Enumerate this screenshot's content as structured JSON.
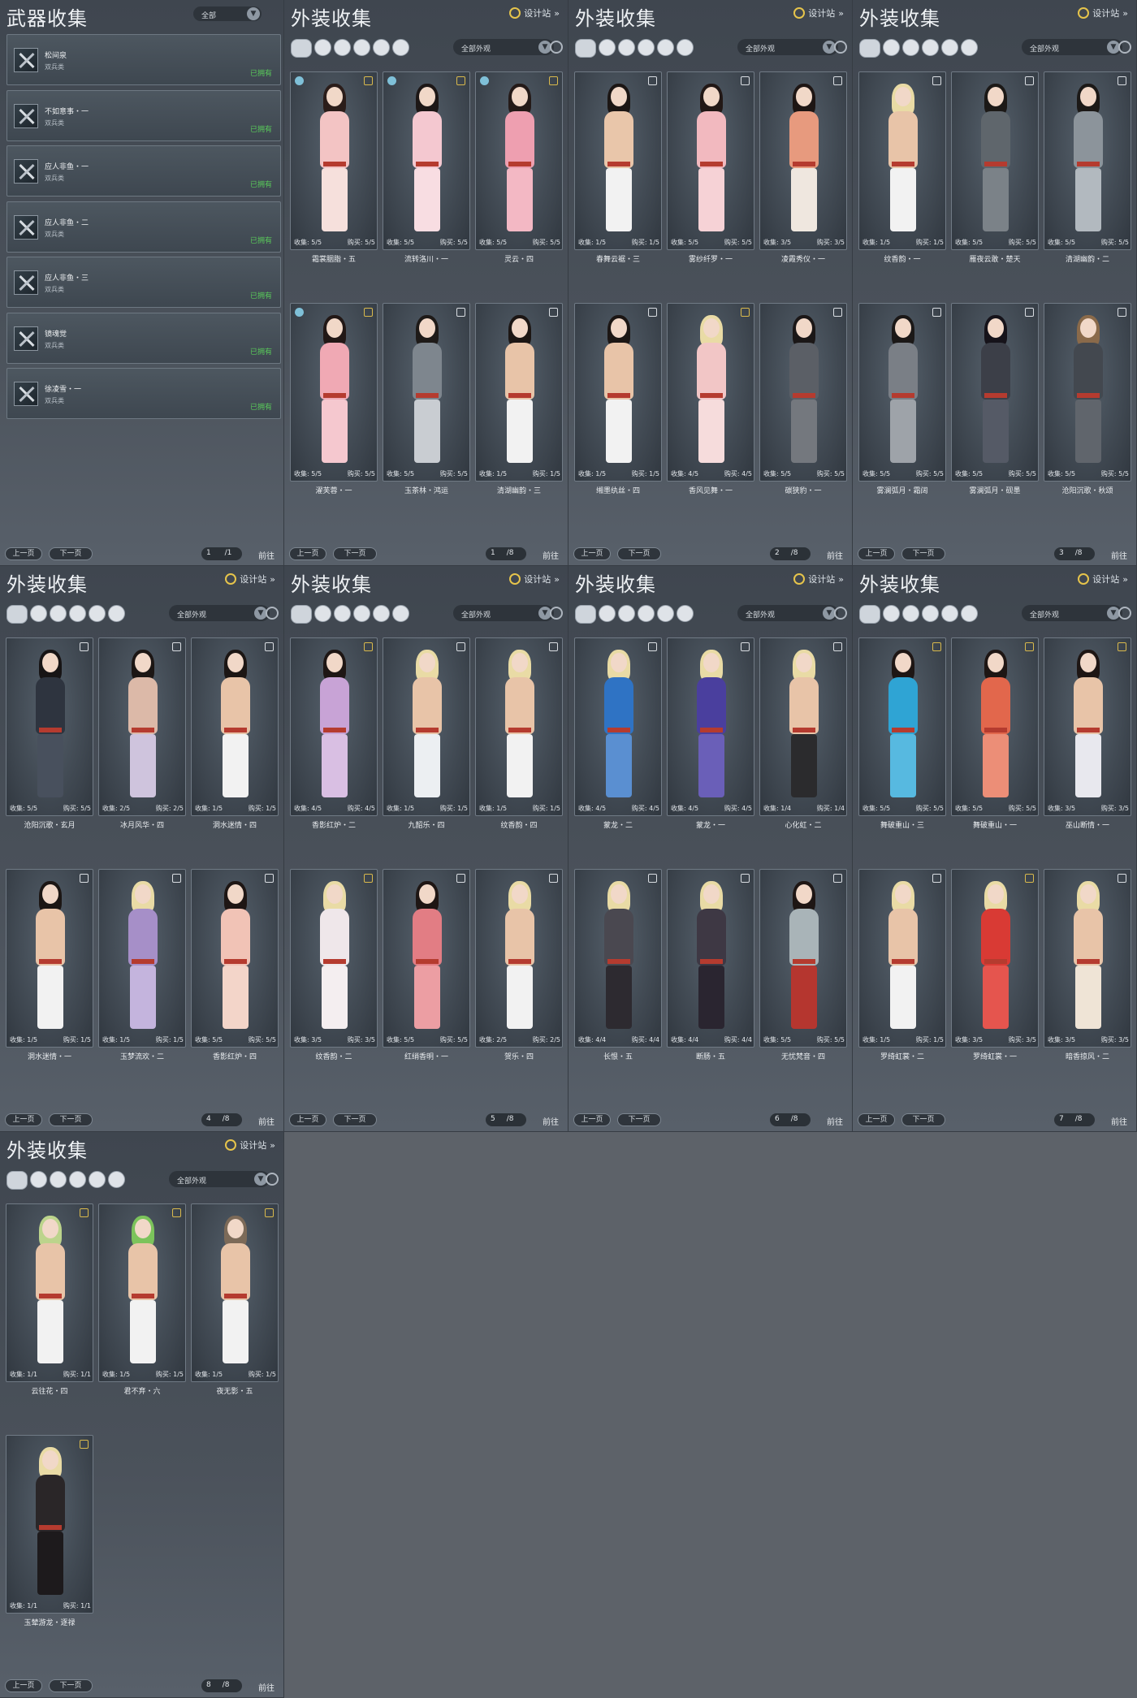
{
  "weapon": {
    "title": "武器收集",
    "filter": "全部",
    "items": [
      {
        "name": "松间泉",
        "type": "双兵类",
        "status": "已拥有"
      },
      {
        "name": "不如意事・一",
        "type": "双兵类",
        "status": "已拥有"
      },
      {
        "name": "应人非鱼・一",
        "type": "双兵类",
        "status": "已拥有"
      },
      {
        "name": "应人非鱼・二",
        "type": "双兵类",
        "status": "已拥有"
      },
      {
        "name": "应人非鱼・三",
        "type": "双兵类",
        "status": "已拥有"
      },
      {
        "name": "镜魂觉",
        "type": "双兵类",
        "status": "已拥有"
      },
      {
        "name": "徐凌雪・一",
        "type": "双兵类",
        "status": "已拥有"
      }
    ],
    "pager": {
      "prev": "上一页",
      "next": "下一页",
      "page": "1",
      "total": "/1",
      "jump": "前往"
    }
  },
  "outfit_common": {
    "title": "外装收集",
    "designer": "设计站",
    "filter": "全部外观",
    "collect_label": "收集:",
    "buy_label": "购买:",
    "prev": "上一页",
    "next": "下一页",
    "jump": "前往"
  },
  "outfit_pages": [
    {
      "page": "1",
      "total": "/8",
      "cards": [
        {
          "name": "霜裳胭脂・五",
          "collect": "5/5",
          "buy": "5/5",
          "tag": "gold",
          "left": true,
          "palette": [
            "#f3c4c4",
            "#2b1d1a",
            "#f6e0dc"
          ]
        },
        {
          "name": "流转洛川・一",
          "collect": "5/5",
          "buy": "5/5",
          "tag": "gold",
          "left": true,
          "palette": [
            "#f4c8d0",
            "#1d1716",
            "#f8dde2"
          ]
        },
        {
          "name": "灵云・四",
          "collect": "5/5",
          "buy": "5/5",
          "tag": "gold",
          "left": true,
          "palette": [
            "#ee9fb0",
            "#241a18",
            "#f3b8c4"
          ]
        },
        {
          "name": "濯芙蓉・一",
          "collect": "5/5",
          "buy": "5/5",
          "tag": "gold",
          "left": true,
          "palette": [
            "#f0a9b4",
            "#221816",
            "#f5c8cf"
          ]
        },
        {
          "name": "玉茶林・鸿运",
          "collect": "5/5",
          "buy": "5/5",
          "tag": "silver",
          "left": false,
          "palette": [
            "#7e868e",
            "#1e1a18",
            "#c9cdd2"
          ]
        },
        {
          "name": "清湖幽韵・三",
          "collect": "1/5",
          "buy": "1/5",
          "tag": "silver",
          "left": false,
          "palette": [
            "#e8c4a8",
            "#1c1614",
            "#f2f2f2"
          ]
        }
      ]
    },
    {
      "page": "2",
      "total": "/8",
      "cards": [
        {
          "name": "春舞云裾・三",
          "collect": "1/5",
          "buy": "1/5",
          "tag": "silver",
          "left": false,
          "palette": [
            "#e9c6aa",
            "#1c1614",
            "#f2f2f2"
          ]
        },
        {
          "name": "雾纱纤罗・一",
          "collect": "5/5",
          "buy": "5/5",
          "tag": "silver",
          "left": false,
          "palette": [
            "#f2b9bf",
            "#221816",
            "#f6d2d6"
          ]
        },
        {
          "name": "凌霞秀仪・一",
          "collect": "3/5",
          "buy": "3/5",
          "tag": "silver",
          "left": false,
          "palette": [
            "#e79a7e",
            "#1e1614",
            "#efe7df"
          ]
        },
        {
          "name": "缃墨纨丝・四",
          "collect": "1/5",
          "buy": "1/5",
          "tag": "silver",
          "left": false,
          "palette": [
            "#e8c4a8",
            "#1c1614",
            "#f2f2f2"
          ]
        },
        {
          "name": "香风见舞・一",
          "collect": "4/5",
          "buy": "4/5",
          "tag": "gold",
          "left": false,
          "palette": [
            "#f2c6c6",
            "#e9dba5",
            "#f6dcdc"
          ]
        },
        {
          "name": "碳狭豹・一",
          "collect": "5/5",
          "buy": "5/5",
          "tag": "silver",
          "left": false,
          "palette": [
            "#5b5f66",
            "#1b1717",
            "#74787e"
          ]
        }
      ]
    },
    {
      "page": "3",
      "total": "/8",
      "cards": [
        {
          "name": "纹香韵・一",
          "collect": "1/5",
          "buy": "1/5",
          "tag": "silver",
          "left": false,
          "palette": [
            "#e8c4a8",
            "#e9dba5",
            "#f2f2f2"
          ]
        },
        {
          "name": "雁夜云敢・楚天",
          "collect": "5/5",
          "buy": "5/5",
          "tag": "silver",
          "left": false,
          "palette": [
            "#5f666c",
            "#1c1917",
            "#7b8288"
          ]
        },
        {
          "name": "清湖幽韵・二",
          "collect": "5/5",
          "buy": "5/5",
          "tag": "silver",
          "left": false,
          "palette": [
            "#8c949b",
            "#1c1917",
            "#b2b9bf"
          ]
        },
        {
          "name": "雾澜弧月・霜阔",
          "collect": "5/5",
          "buy": "5/5",
          "tag": "silver",
          "left": false,
          "palette": [
            "#7a7f86",
            "#1b1817",
            "#9ea3a9"
          ]
        },
        {
          "name": "雾澜弧月・砚墨",
          "collect": "5/5",
          "buy": "5/5",
          "tag": "silver",
          "left": false,
          "palette": [
            "#3c3f48",
            "#16131a",
            "#555a66"
          ]
        },
        {
          "name": "沧阳沉歌・秋颂",
          "collect": "5/5",
          "buy": "5/5",
          "tag": "silver",
          "left": false,
          "palette": [
            "#43484f",
            "#8a6a4a",
            "#60656c"
          ]
        }
      ]
    },
    {
      "page": "4",
      "total": "/8",
      "cards": [
        {
          "name": "沧阳沉歌・玄月",
          "collect": "5/5",
          "buy": "5/5",
          "tag": "silver",
          "left": false,
          "palette": [
            "#2e343f",
            "#171415",
            "#48505d"
          ]
        },
        {
          "name": "冰月风华・四",
          "collect": "2/5",
          "buy": "2/5",
          "tag": "silver",
          "left": false,
          "palette": [
            "#dcb9a8",
            "#1c1614",
            "#cfc4dd"
          ]
        },
        {
          "name": "洞水迷情・四",
          "collect": "1/5",
          "buy": "1/5",
          "tag": "silver",
          "left": false,
          "palette": [
            "#e8c4a8",
            "#1c1614",
            "#f2f2f2"
          ]
        },
        {
          "name": "洞水迷情・一",
          "collect": "1/5",
          "buy": "1/5",
          "tag": "silver",
          "left": false,
          "palette": [
            "#e8c4a8",
            "#1c1614",
            "#f2f2f2"
          ]
        },
        {
          "name": "玉梦流欢・二",
          "collect": "1/5",
          "buy": "1/5",
          "tag": "silver",
          "left": false,
          "palette": [
            "#a68fc8",
            "#e9dba5",
            "#c4b4dd"
          ]
        },
        {
          "name": "香影红炉・四",
          "collect": "5/5",
          "buy": "5/5",
          "tag": "silver",
          "left": false,
          "palette": [
            "#f1c3b6",
            "#1e1614",
            "#f3d5c9"
          ]
        }
      ]
    },
    {
      "page": "5",
      "total": "/8",
      "cards": [
        {
          "name": "香影红炉・二",
          "collect": "4/5",
          "buy": "4/5",
          "tag": "gold",
          "left": false,
          "palette": [
            "#c8a3d6",
            "#1e1614",
            "#d9bfe3"
          ]
        },
        {
          "name": "九韶乐・四",
          "collect": "1/5",
          "buy": "1/5",
          "tag": "silver",
          "left": false,
          "palette": [
            "#e8c4a8",
            "#e9dba5",
            "#eceff2"
          ]
        },
        {
          "name": "纹香韵・四",
          "collect": "1/5",
          "buy": "1/5",
          "tag": "silver",
          "left": false,
          "palette": [
            "#e8c4a8",
            "#e9dba5",
            "#f2f2f2"
          ]
        },
        {
          "name": "纹香韵・二",
          "collect": "3/5",
          "buy": "3/5",
          "tag": "gold",
          "left": false,
          "palette": [
            "#efe7ea",
            "#e9dba5",
            "#f4eef0"
          ]
        },
        {
          "name": "红绡香明・一",
          "collect": "5/5",
          "buy": "5/5",
          "tag": "silver",
          "left": false,
          "palette": [
            "#e27d84",
            "#1e1614",
            "#ec9ea3"
          ]
        },
        {
          "name": "贺乐・四",
          "collect": "2/5",
          "buy": "2/5",
          "tag": "silver",
          "left": false,
          "palette": [
            "#e8c4a8",
            "#e9dba5",
            "#f2f2f2"
          ]
        }
      ]
    },
    {
      "page": "6",
      "total": "/8",
      "cards": [
        {
          "name": "蒙龙・二",
          "collect": "4/5",
          "buy": "4/5",
          "tag": "silver",
          "left": false,
          "palette": [
            "#2f73c4",
            "#e9dba5",
            "#5a8fd1"
          ]
        },
        {
          "name": "蒙龙・一",
          "collect": "4/5",
          "buy": "4/5",
          "tag": "silver",
          "left": false,
          "palette": [
            "#4a3f9e",
            "#e9dba5",
            "#6a5fb8"
          ]
        },
        {
          "name": "心化虹・二",
          "collect": "1/4",
          "buy": "1/4",
          "tag": "silver",
          "left": false,
          "palette": [
            "#e8c4a8",
            "#e9dba5",
            "#2b2b2d"
          ]
        },
        {
          "name": "长恨・五",
          "collect": "4/4",
          "buy": "4/4",
          "tag": "silver",
          "left": false,
          "palette": [
            "#4a4850",
            "#e9dba5",
            "#2d2a30"
          ]
        },
        {
          "name": "断肠・五",
          "collect": "4/4",
          "buy": "4/4",
          "tag": "silver",
          "left": false,
          "palette": [
            "#3e3844",
            "#e9dba5",
            "#2a2530"
          ]
        },
        {
          "name": "无忧梵音・四",
          "collect": "5/5",
          "buy": "5/5",
          "tag": "silver",
          "left": false,
          "palette": [
            "#a9b4b8",
            "#1e1614",
            "#b5362f"
          ]
        }
      ]
    },
    {
      "page": "7",
      "total": "/8",
      "cards": [
        {
          "name": "舞破重山・三",
          "collect": "5/5",
          "buy": "5/5",
          "tag": "gold",
          "left": false,
          "palette": [
            "#2fa4d4",
            "#1e1614",
            "#57b9e0"
          ]
        },
        {
          "name": "舞破重山・一",
          "collect": "5/5",
          "buy": "5/5",
          "tag": "gold",
          "left": false,
          "palette": [
            "#e2674c",
            "#1e1614",
            "#ec8e77"
          ]
        },
        {
          "name": "巫山断情・一",
          "collect": "3/5",
          "buy": "3/5",
          "tag": "gold",
          "left": false,
          "palette": [
            "#e8c4a8",
            "#1e1614",
            "#e8e8ee"
          ]
        },
        {
          "name": "罗绮虹裳・二",
          "collect": "1/5",
          "buy": "1/5",
          "tag": "silver",
          "left": false,
          "palette": [
            "#e8c4a8",
            "#e9dba5",
            "#f2f2f2"
          ]
        },
        {
          "name": "罗绮虹裳・一",
          "collect": "3/5",
          "buy": "3/5",
          "tag": "gold",
          "left": false,
          "palette": [
            "#d93a34",
            "#e9dba5",
            "#e5554e"
          ]
        },
        {
          "name": "暗香掠风・二",
          "collect": "3/5",
          "buy": "3/5",
          "tag": "silver",
          "left": false,
          "palette": [
            "#e8c4a8",
            "#e9dba5",
            "#efe4d6"
          ]
        }
      ]
    },
    {
      "page": "8",
      "total": "/8",
      "cards": [
        {
          "name": "云往花・四",
          "collect": "1/1",
          "buy": "1/1",
          "tag": "gold",
          "left": false,
          "palette": [
            "#e8c4a8",
            "#bcd48c",
            "#f2f2f2"
          ]
        },
        {
          "name": "君不弃・六",
          "collect": "1/5",
          "buy": "1/5",
          "tag": "gold",
          "left": false,
          "palette": [
            "#e8c4a8",
            "#7bc35b",
            "#f2f2f2"
          ]
        },
        {
          "name": "夜无影・五",
          "collect": "1/5",
          "buy": "1/5",
          "tag": "gold",
          "left": false,
          "palette": [
            "#e8c4a8",
            "#7c6a58",
            "#f2f2f2"
          ]
        },
        {
          "name": "玉辇游龙・逐禄",
          "collect": "1/1",
          "buy": "1/1",
          "tag": "gold",
          "left": false,
          "palette": [
            "#2a2628",
            "#e9dba5",
            "#1d1a1c"
          ]
        }
      ]
    }
  ]
}
